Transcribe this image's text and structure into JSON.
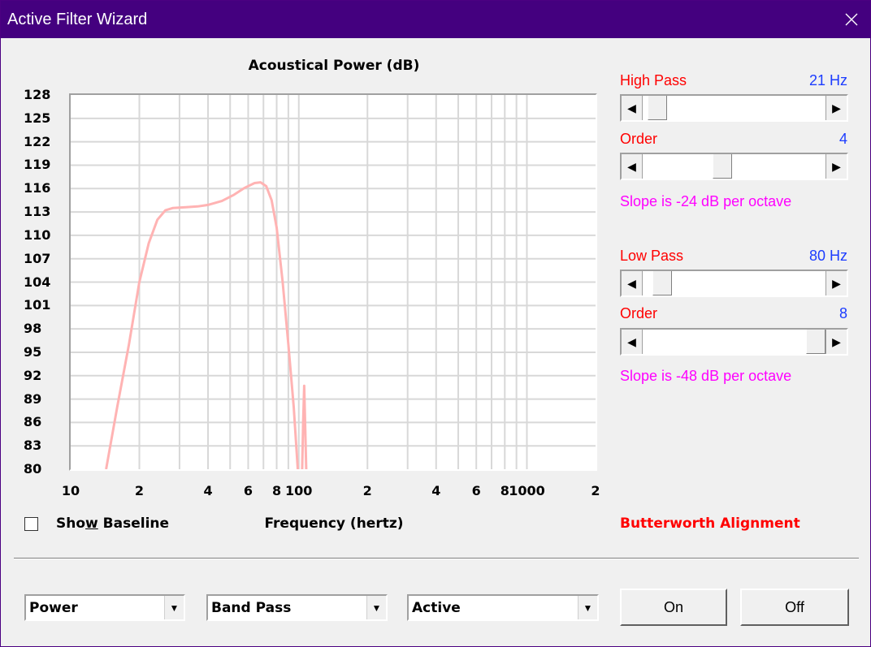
{
  "window": {
    "title": "Active Filter Wizard"
  },
  "chart_data": {
    "type": "line",
    "title": "Acoustical Power (dB)",
    "xlabel": "Frequency (hertz)",
    "ylabel": "",
    "x_scale": "log",
    "xlim": [
      10,
      2000
    ],
    "ylim": [
      80,
      128
    ],
    "y_ticks": [
      "128",
      "125",
      "122",
      "119",
      "116",
      "113",
      "110",
      "107",
      "104",
      "101",
      "98",
      "95",
      "92",
      "89",
      "86",
      "83",
      "80"
    ],
    "x_ticks": [
      {
        "value": 10,
        "label": "10"
      },
      {
        "value": 20,
        "label": "2"
      },
      {
        "value": 40,
        "label": "4"
      },
      {
        "value": 60,
        "label": "6"
      },
      {
        "value": 80,
        "label": "8"
      },
      {
        "value": 100,
        "label": "100"
      },
      {
        "value": 200,
        "label": "2"
      },
      {
        "value": 400,
        "label": "4"
      },
      {
        "value": 600,
        "label": "6"
      },
      {
        "value": 800,
        "label": "8"
      },
      {
        "value": 1000,
        "label": "1000"
      },
      {
        "value": 2000,
        "label": "2"
      }
    ],
    "grid": true,
    "line_color": "#ffb3b3",
    "series": [
      {
        "values": [
          [
            14.3,
            80
          ],
          [
            16,
            88
          ],
          [
            18,
            96
          ],
          [
            20,
            104
          ],
          [
            22,
            109
          ],
          [
            24,
            112
          ],
          [
            26,
            113.2
          ],
          [
            28,
            113.5
          ],
          [
            32,
            113.6
          ],
          [
            36,
            113.7
          ],
          [
            40,
            113.9
          ],
          [
            46,
            114.4
          ],
          [
            52,
            115.2
          ],
          [
            58,
            116.1
          ],
          [
            64,
            116.7
          ],
          [
            68,
            116.8
          ],
          [
            72,
            116.3
          ],
          [
            76,
            114.5
          ],
          [
            80,
            111
          ],
          [
            85,
            104
          ],
          [
            90,
            96
          ],
          [
            95,
            88
          ],
          [
            99,
            80
          ]
        ]
      },
      {
        "values": [
          [
            103.5,
            80
          ],
          [
            104.5,
            86
          ],
          [
            105.6,
            90.7
          ],
          [
            106.6,
            86
          ],
          [
            107.8,
            80
          ]
        ]
      }
    ]
  },
  "show_baseline": {
    "label_before": "Sho",
    "label_mnemonic": "w",
    "label_after": " Baseline",
    "checked": false
  },
  "high_pass": {
    "label": "High Pass",
    "value": "21 Hz",
    "position": 0.03
  },
  "high_pass_order": {
    "label": "Order",
    "value": "4",
    "position": 0.43,
    "slope": "Slope is -24 dB per octave"
  },
  "low_pass": {
    "label": "Low Pass",
    "value": "80 Hz",
    "position": 0.06
  },
  "low_pass_order": {
    "label": "Order",
    "value": "8",
    "position": 1.0,
    "slope": "Slope is -48 dB per octave"
  },
  "alignment": "Butterworth Alignment",
  "combos": {
    "mode": "Power",
    "filter_type": "Band Pass",
    "filter_kind": "Active"
  },
  "buttons": {
    "on": "On",
    "off": "Off"
  },
  "colors": {
    "titlebar": "#44007f",
    "label_red": "#ff0000",
    "value_blue": "#1c3cff",
    "slope_magenta": "#ff00ff"
  },
  "icons": {
    "close": "close-icon",
    "scroll_left": "arrow-left-icon",
    "scroll_right": "arrow-right-icon",
    "dropdown": "chevron-down-icon"
  }
}
